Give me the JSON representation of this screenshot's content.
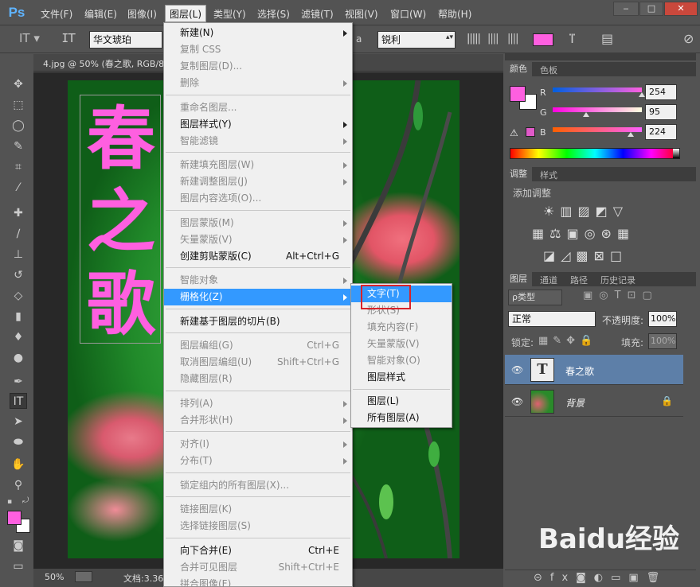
{
  "app": {
    "logo": "Ps"
  },
  "menubar": [
    "文件(F)",
    "编辑(E)",
    "图像(I)",
    "图层(L)",
    "类型(Y)",
    "选择(S)",
    "滤镜(T)",
    "视图(V)",
    "窗口(W)",
    "帮助(H)"
  ],
  "options": {
    "font": "华文琥珀",
    "aa_label": "a",
    "aa": "锐利"
  },
  "document": {
    "tab": "4.jpg @ 50% (春之歌, RGB/8",
    "zoom": "50%",
    "docinfo": "文档:3.36",
    "text": "春之歌",
    "text_color": "#fe5fe0"
  },
  "layer_menu": [
    {
      "label": "新建(N)",
      "sub": true
    },
    {
      "label": "复制 CSS",
      "dis": true
    },
    {
      "label": "复制图层(D)...",
      "dis": true
    },
    {
      "label": "删除",
      "dis": true,
      "sub": true
    },
    {
      "sep": true
    },
    {
      "label": "重命名图层...",
      "dis": true
    },
    {
      "label": "图层样式(Y)",
      "sub": true
    },
    {
      "label": "智能滤镜",
      "dis": true,
      "sub": true
    },
    {
      "sep": true
    },
    {
      "label": "新建填充图层(W)",
      "dis": true,
      "sub": true
    },
    {
      "label": "新建调整图层(J)",
      "dis": true,
      "sub": true
    },
    {
      "label": "图层内容选项(O)...",
      "dis": true
    },
    {
      "sep": true
    },
    {
      "label": "图层蒙版(M)",
      "dis": true,
      "sub": true
    },
    {
      "label": "矢量蒙版(V)",
      "dis": true,
      "sub": true
    },
    {
      "label": "创建剪贴蒙版(C)",
      "shortcut": "Alt+Ctrl+G"
    },
    {
      "sep": true
    },
    {
      "label": "智能对象",
      "dis": true,
      "sub": true
    },
    {
      "label": "栅格化(Z)",
      "hl": true,
      "sub": true
    },
    {
      "sep": true
    },
    {
      "label": "新建基于图层的切片(B)"
    },
    {
      "sep": true
    },
    {
      "label": "图层编组(G)",
      "dis": true,
      "shortcut": "Ctrl+G"
    },
    {
      "label": "取消图层编组(U)",
      "dis": true,
      "shortcut": "Shift+Ctrl+G"
    },
    {
      "label": "隐藏图层(R)",
      "dis": true
    },
    {
      "sep": true
    },
    {
      "label": "排列(A)",
      "dis": true,
      "sub": true
    },
    {
      "label": "合并形状(H)",
      "dis": true,
      "sub": true
    },
    {
      "sep": true
    },
    {
      "label": "对齐(I)",
      "dis": true,
      "sub": true
    },
    {
      "label": "分布(T)",
      "dis": true,
      "sub": true
    },
    {
      "sep": true
    },
    {
      "label": "锁定组内的所有图层(X)...",
      "dis": true
    },
    {
      "sep": true
    },
    {
      "label": "链接图层(K)",
      "dis": true
    },
    {
      "label": "选择链接图层(S)",
      "dis": true
    },
    {
      "sep": true
    },
    {
      "label": "向下合并(E)",
      "shortcut": "Ctrl+E"
    },
    {
      "label": "合并可见图层",
      "dis": true,
      "shortcut": "Shift+Ctrl+E"
    },
    {
      "label": "拼合图像(F)",
      "dis": true
    }
  ],
  "raster_menu": [
    {
      "label": "文字(T)",
      "hl": true
    },
    {
      "label": "形状(S)",
      "dis": true
    },
    {
      "label": "填充内容(F)",
      "dis": true
    },
    {
      "label": "矢量蒙版(V)",
      "dis": true
    },
    {
      "label": "智能对象(O)",
      "dis": true
    },
    {
      "label": "图层样式"
    },
    {
      "sep": true
    },
    {
      "label": "图层(L)"
    },
    {
      "label": "所有图层(A)"
    }
  ],
  "color_panel": {
    "tabs": [
      "颜色",
      "色板"
    ],
    "r_label": "R",
    "g_label": "G",
    "b_label": "B",
    "r": "254",
    "g": "95",
    "b": "224",
    "r_frac": 0.996,
    "g_frac": 0.373,
    "b_frac": 0.878,
    "fg": "#fe5fe0"
  },
  "adjust_panel": {
    "tabs": [
      "调整",
      "样式"
    ],
    "title": "添加调整"
  },
  "layers_panel": {
    "tabs": [
      "图层",
      "通道",
      "路径",
      "历史记录"
    ],
    "filter": "ρ类型",
    "blend": "正常",
    "opacity_label": "不透明度:",
    "opacity": "100%",
    "lock_label": "锁定:",
    "fill_label": "填充:",
    "fill": "100%",
    "layers": [
      {
        "name": "春之歌",
        "type": "text",
        "selected": true
      },
      {
        "name": "背景",
        "type": "image",
        "locked": true
      }
    ]
  },
  "watermark": "Baidu经验"
}
